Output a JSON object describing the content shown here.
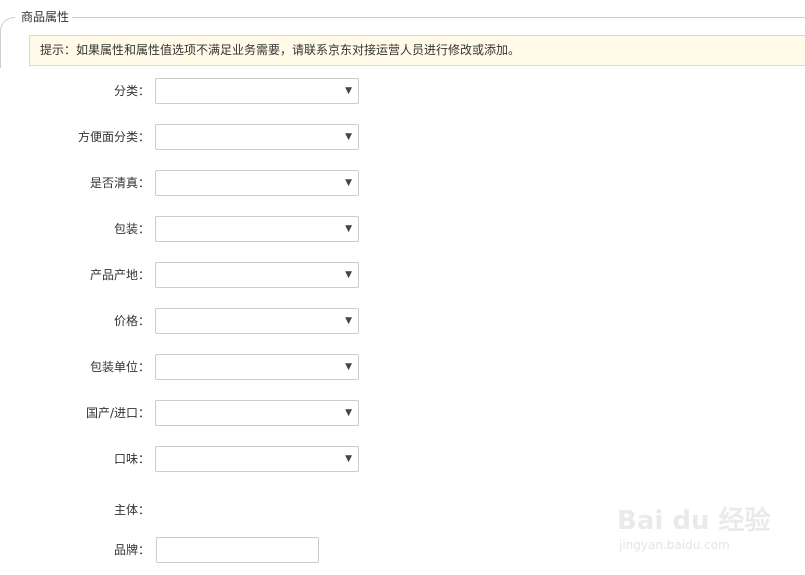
{
  "section": {
    "legend": "商品属性",
    "notice": "提示：如果属性和属性值选项不满足业务需要，请联系京东对接运营人员进行修改或添加。"
  },
  "fields": [
    {
      "label": "分类：",
      "value": ""
    },
    {
      "label": "方便面分类：",
      "value": ""
    },
    {
      "label": "是否清真：",
      "value": ""
    },
    {
      "label": "包装：",
      "value": ""
    },
    {
      "label": "产品产地：",
      "value": ""
    },
    {
      "label": "价格：",
      "value": ""
    },
    {
      "label": "包装单位：",
      "value": ""
    },
    {
      "label": "国产/进口：",
      "value": ""
    },
    {
      "label": "口味：",
      "value": ""
    }
  ],
  "subject": {
    "label": "主体："
  },
  "brand": {
    "label": "品牌：",
    "value": ""
  },
  "icons": {
    "dropdown": "caret-down-icon"
  },
  "watermark": {
    "main": "Bai du 经验",
    "sub": "jingyan.baidu.com"
  }
}
